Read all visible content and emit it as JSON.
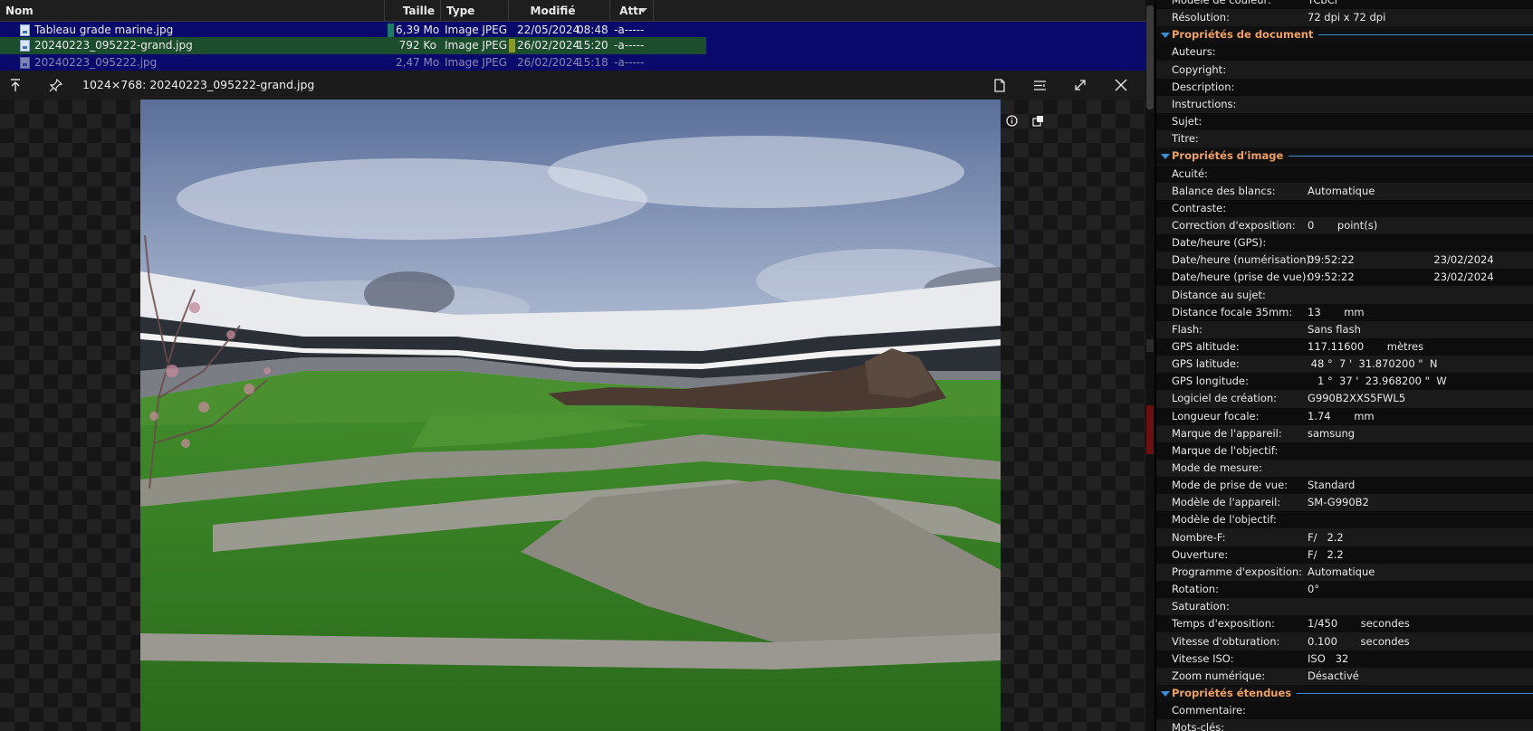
{
  "file_list": {
    "columns": {
      "name": "Nom",
      "size": "Taille",
      "type": "Type",
      "modified": "Modifié",
      "attr": "Attr"
    },
    "rows": [
      {
        "name": "Tableau grade marine.jpg",
        "size": "6,39 Mo",
        "type": "Image JPEG",
        "date": "22/05/2024",
        "time": "08:48",
        "attr": "-a-----",
        "selected": false
      },
      {
        "name": "20240223_095222-grand.jpg",
        "size": "792 Ko",
        "type": "Image JPEG",
        "date": "26/02/2024",
        "time": "15:20",
        "attr": "-a-----",
        "selected": true
      },
      {
        "name": "20240223_095222.jpg",
        "size": "2,47 Mo",
        "type": "Image JPEG",
        "date": "26/02/2024",
        "time": "15:18",
        "attr": "-a-----",
        "selected": false
      }
    ]
  },
  "viewer": {
    "title": "1024×768: 20240223_095222-grand.jpg",
    "icons": {
      "go_top": "arrow-to-top-icon",
      "pin": "pin-icon",
      "document": "document-icon",
      "list": "list-icon",
      "fullscreen": "expand-icon",
      "close": "close-icon",
      "info": "info-icon",
      "fit": "fit-window-icon"
    }
  },
  "properties": {
    "top_rows": [
      {
        "label": "Modèle de couleur:",
        "value": "YCbCr"
      },
      {
        "label": "Résolution:",
        "value": "72 dpi x 72 dpi"
      }
    ],
    "sections": [
      {
        "title": "Propriétés de document",
        "rows": [
          {
            "label": "Auteurs:",
            "value": ""
          },
          {
            "label": "Copyright:",
            "value": ""
          },
          {
            "label": "Description:",
            "value": ""
          },
          {
            "label": "Instructions:",
            "value": ""
          },
          {
            "label": "Sujet:",
            "value": ""
          },
          {
            "label": "Titre:",
            "value": ""
          }
        ]
      },
      {
        "title": "Propriétés d'image",
        "rows": [
          {
            "label": "Acuité:",
            "value": ""
          },
          {
            "label": "Balance des blancs:",
            "value": "Automatique"
          },
          {
            "label": "Contraste:",
            "value": ""
          },
          {
            "label": "Correction d'exposition:",
            "value": "0       point(s)"
          },
          {
            "label": "Date/heure (GPS):",
            "value": ""
          },
          {
            "label": "Date/heure (numérisation):",
            "value": "09:52:22                        23/02/2024"
          },
          {
            "label": "Date/heure (prise de vue):",
            "value": "09:52:22                        23/02/2024"
          },
          {
            "label": "Distance au sujet:",
            "value": ""
          },
          {
            "label": "Distance focale 35mm:",
            "value": "13       mm"
          },
          {
            "label": "Flash:",
            "value": "Sans flash"
          },
          {
            "label": "GPS altitude:",
            "value": "117.11600       mètres"
          },
          {
            "label": "GPS latitude:",
            "value": " 48 °  7 '  31.870200 \"  N"
          },
          {
            "label": "GPS longitude:",
            "value": "   1 °  37 '  23.968200 \"  W"
          },
          {
            "label": "Logiciel de création:",
            "value": "G990B2XXS5FWL5"
          },
          {
            "label": "Longueur focale:",
            "value": "1.74       mm"
          },
          {
            "label": "Marque de l'appareil:",
            "value": "samsung"
          },
          {
            "label": "Marque de l'objectif:",
            "value": ""
          },
          {
            "label": "Mode de mesure:",
            "value": ""
          },
          {
            "label": "Mode de prise de vue:",
            "value": "Standard"
          },
          {
            "label": "Modèle de l'appareil:",
            "value": "SM-G990B2"
          },
          {
            "label": "Modèle de l'objectif:",
            "value": ""
          },
          {
            "label": "Nombre-F:",
            "value": "F/   2.2"
          },
          {
            "label": "Ouverture:",
            "value": "F/   2.2"
          },
          {
            "label": "Programme d'exposition:",
            "value": "Automatique"
          },
          {
            "label": "Rotation:",
            "value": "0°"
          },
          {
            "label": "Saturation:",
            "value": ""
          },
          {
            "label": "Temps d'exposition:",
            "value": "1/450       secondes"
          },
          {
            "label": "Vitesse d'obturation:",
            "value": "0.100       secondes"
          },
          {
            "label": "Vitesse ISO:",
            "value": "ISO   32"
          },
          {
            "label": "Zoom numérique:",
            "value": "Désactivé"
          }
        ]
      },
      {
        "title": "Propriétés étendues",
        "rows": [
          {
            "label": "Commentaire:",
            "value": ""
          },
          {
            "label": "Mots-clés:",
            "value": ""
          }
        ]
      }
    ]
  },
  "colors": {
    "accent": "#3e8ed6",
    "section_title": "#f0a060",
    "list_bg": "#0a0a6c",
    "selected_row": "#1c4d2c"
  }
}
